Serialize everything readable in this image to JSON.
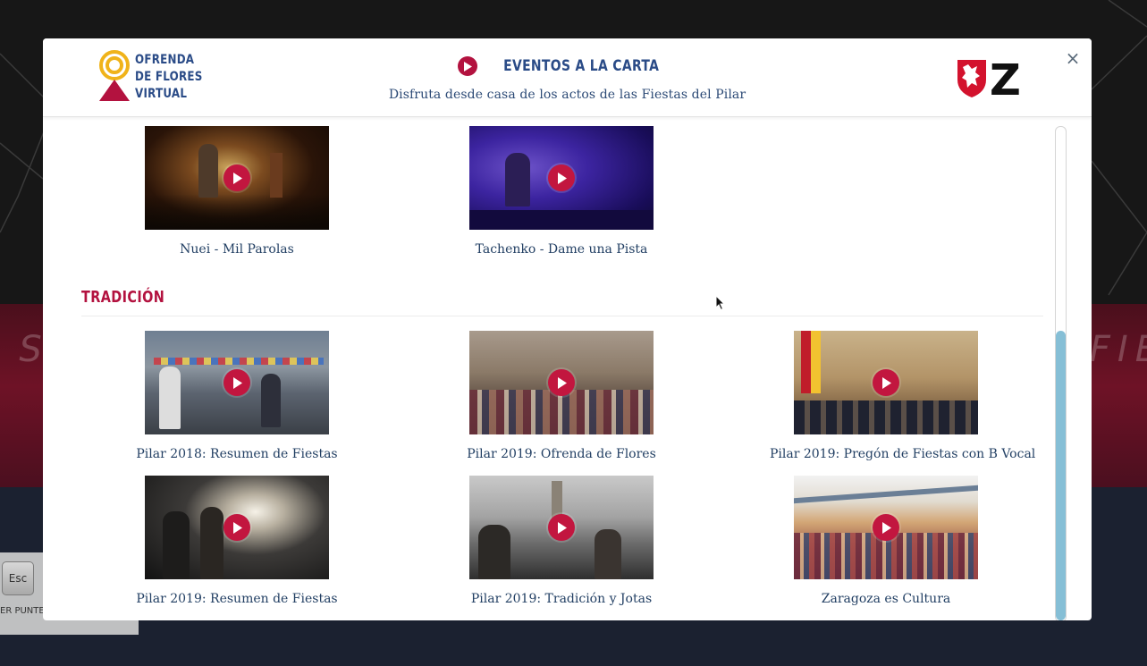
{
  "modal": {
    "logo_lines": [
      "OFRENDA",
      "DE FLORES",
      "VIRTUAL"
    ],
    "title": "EVENTOS A LA CARTA",
    "subtitle": "Disfruta desde casa de los actos de las Fiestas del Pilar",
    "close_label": "×",
    "brand_letter": "Z"
  },
  "top_row": [
    {
      "title": "Nuei - Mil Parolas"
    },
    {
      "title": "Tachenko - Dame una Pista"
    }
  ],
  "section": {
    "title": "TRADICIÓN",
    "videos": [
      {
        "title": "Pilar 2018: Resumen de Fiestas"
      },
      {
        "title": "Pilar 2019: Ofrenda de Flores"
      },
      {
        "title": "Pilar 2019: Pregón de Fiestas con B Vocal"
      },
      {
        "title": "Pilar 2019: Resumen de Fiestas"
      },
      {
        "title": "Pilar 2019: Tradición y Jotas"
      },
      {
        "title": "Zaragoza es Cultura"
      }
    ]
  },
  "background": {
    "esc_key": "Esc",
    "esc_hint": "ER PUNTER",
    "band_text_left": ". S",
    "band_text_right": "Y FIE"
  },
  "colors": {
    "accent": "#b3123f",
    "title_blue": "#2a4b87",
    "scroll_thumb": "#86bfd6"
  }
}
